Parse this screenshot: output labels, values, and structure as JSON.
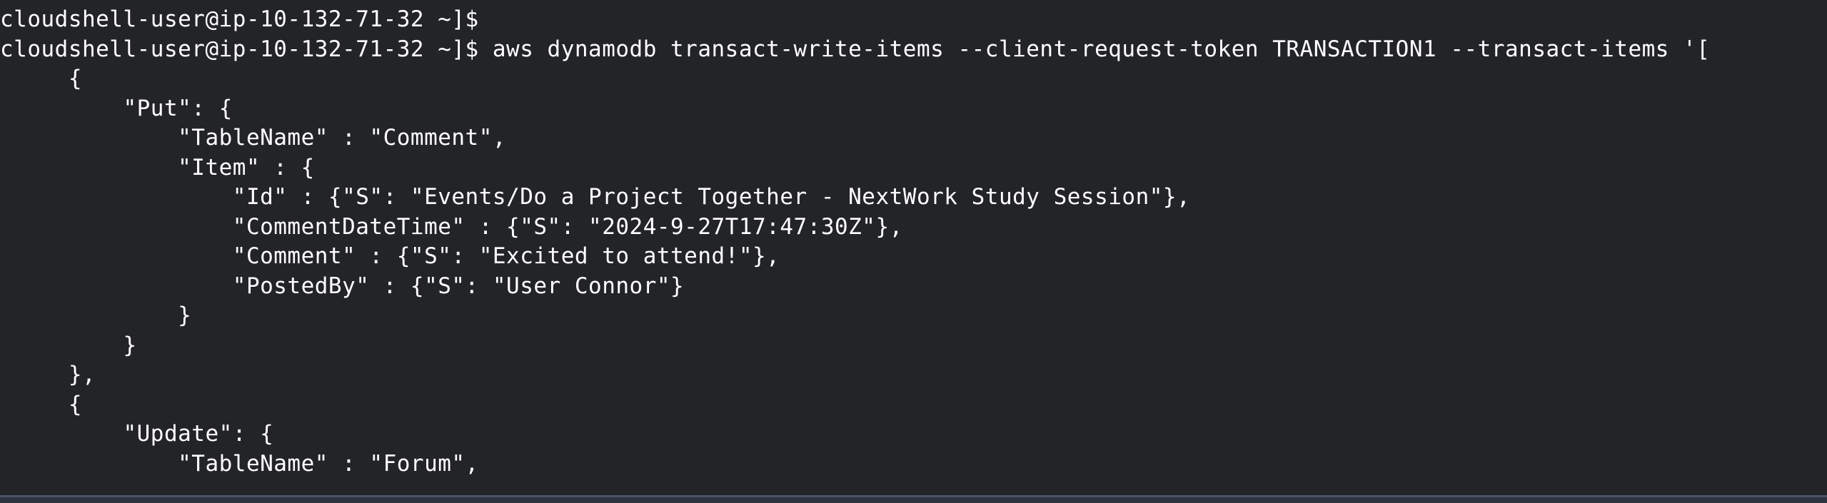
{
  "terminal": {
    "lines": [
      "cloudshell-user@ip-10-132-71-32 ~]$",
      "cloudshell-user@ip-10-132-71-32 ~]$ aws dynamodb transact-write-items --client-request-token TRANSACTION1 --transact-items '[",
      "     {",
      "         \"Put\": {",
      "             \"TableName\" : \"Comment\",",
      "             \"Item\" : {",
      "                 \"Id\" : {\"S\": \"Events/Do a Project Together - NextWork Study Session\"},",
      "                 \"CommentDateTime\" : {\"S\": \"2024-9-27T17:47:30Z\"},",
      "                 \"Comment\" : {\"S\": \"Excited to attend!\"},",
      "                 \"PostedBy\" : {\"S\": \"User Connor\"}",
      "             }",
      "         }",
      "     },",
      "     {",
      "         \"Update\": {",
      "             \"TableName\" : \"Forum\","
    ]
  }
}
